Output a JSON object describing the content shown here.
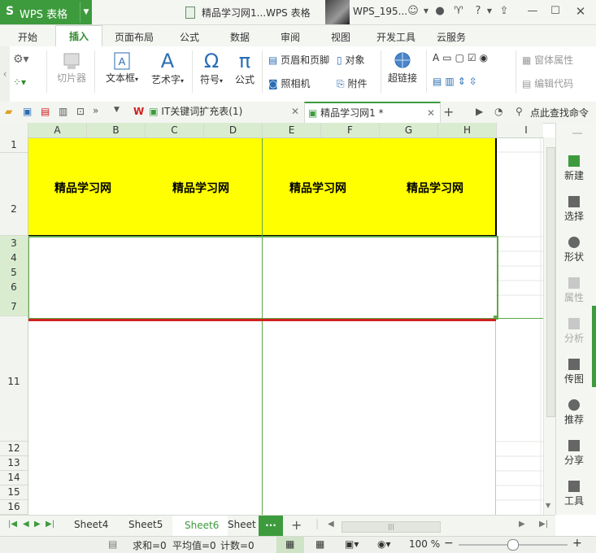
{
  "app": {
    "logo": "S",
    "name": "WPS 表格"
  },
  "window": {
    "doc_title": "精品学习网1...WPS 表格",
    "user": "WPS_195..."
  },
  "ribbon_tabs": [
    "开始",
    "插入",
    "页面布局",
    "公式",
    "数据",
    "审阅",
    "视图",
    "开发工具",
    "云服务"
  ],
  "ribbon": {
    "slicer": "切片器",
    "textbox": "文本框",
    "wordart": "艺术字",
    "symbol": "符号",
    "formula": "公式",
    "header_footer": "页眉和页脚",
    "object": "对象",
    "camera": "照相机",
    "attachment": "附件",
    "hyperlink": "超链接",
    "form_props": "窗体属性",
    "edit_code": "编辑代码"
  },
  "doc_tabs": [
    {
      "label": "IT关键词扩充表(1)"
    },
    {
      "label": "精品学习网1 *"
    }
  ],
  "doc_search": "点此查找命令",
  "columns": [
    "A",
    "B",
    "C",
    "D",
    "E",
    "F",
    "G",
    "H",
    "I"
  ],
  "rows": [
    "1",
    "2",
    "3",
    "4",
    "5",
    "6",
    "7",
    "11",
    "12",
    "13",
    "14",
    "15",
    "16"
  ],
  "cells": {
    "b2_1": "精品学习网",
    "b2_2": "精品学习网",
    "b2_3": "精品学习网",
    "b2_4": "精品学习网"
  },
  "right_panel": [
    {
      "label": "新建",
      "icon": "new-doc-icon",
      "enabled": true
    },
    {
      "label": "选择",
      "icon": "select-icon",
      "enabled": true
    },
    {
      "label": "形状",
      "icon": "shape-icon",
      "enabled": true
    },
    {
      "label": "属性",
      "icon": "property-icon",
      "enabled": false
    },
    {
      "label": "分析",
      "icon": "analysis-icon",
      "enabled": false
    },
    {
      "label": "传图",
      "icon": "upload-image-icon",
      "enabled": true
    },
    {
      "label": "推荐",
      "icon": "recommend-icon",
      "enabled": true
    },
    {
      "label": "分享",
      "icon": "share-icon",
      "enabled": true
    },
    {
      "label": "工具",
      "icon": "toolbox-icon",
      "enabled": true
    }
  ],
  "sheets": [
    "Sheet4",
    "Sheet5",
    "Sheet6",
    "Sheet"
  ],
  "active_sheet": "Sheet6",
  "status": {
    "sum": "求和=0",
    "avg": "平均值=0",
    "count": "计数=0",
    "zoom": "100 %"
  },
  "colors": {
    "accent": "#3d9b3d",
    "yellow": "#ffff00",
    "selection": "#5fa84a",
    "red_line": "#d02020"
  }
}
